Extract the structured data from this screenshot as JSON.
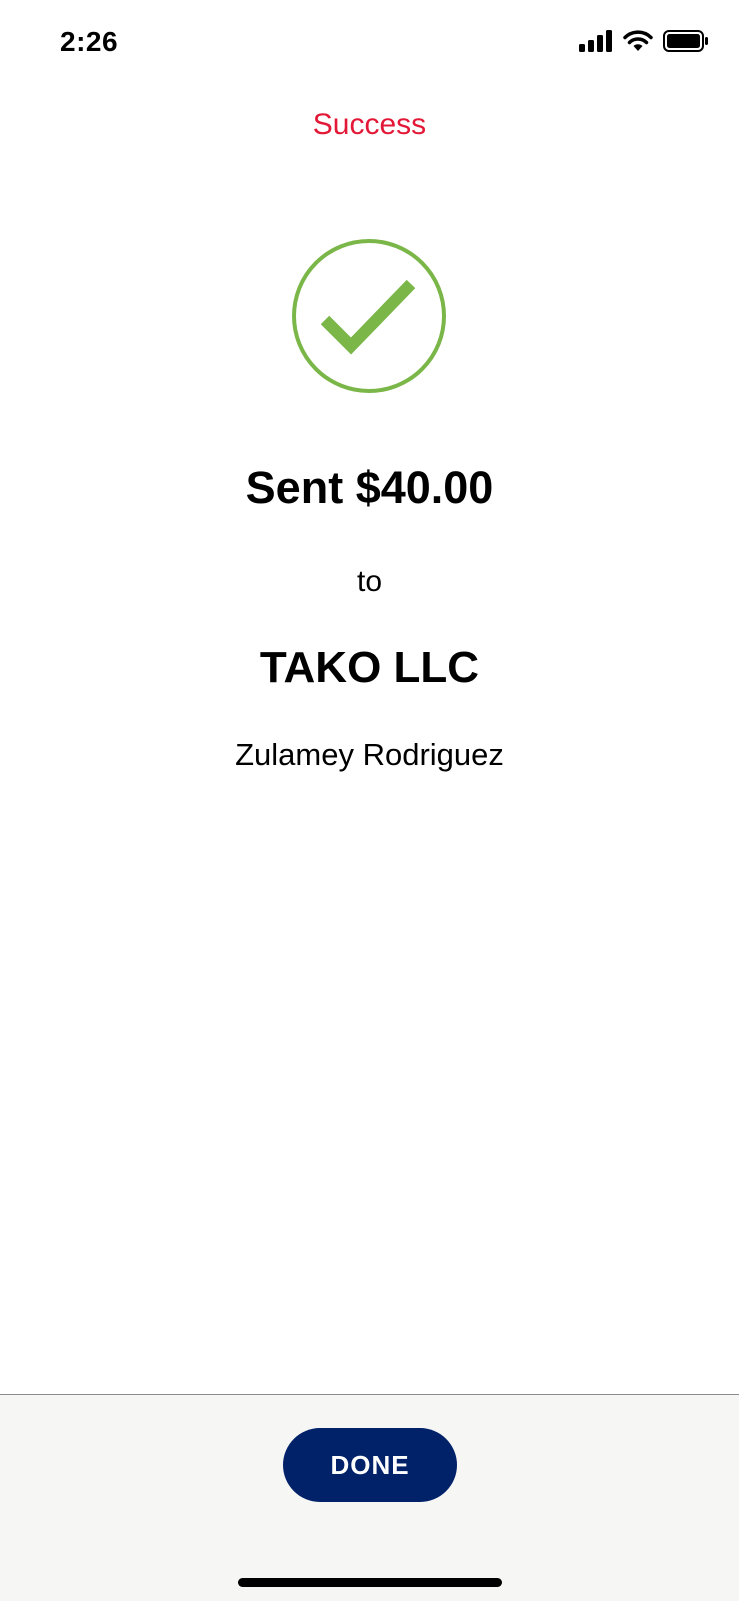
{
  "status_bar": {
    "time": "2:26",
    "icons": [
      "signal-icon",
      "wifi-icon",
      "battery-icon"
    ]
  },
  "header": {
    "title": "Success"
  },
  "confirmation": {
    "icon": "check-circle-icon",
    "amount_text": "Sent $40.00",
    "connector_text": "to",
    "recipient_name": "TAKO LLC",
    "contact_name": "Zulamey Rodriguez"
  },
  "footer": {
    "done_label": "DONE"
  },
  "colors": {
    "title_red": "#e31837",
    "success_green": "#7ab648",
    "button_navy": "#012169",
    "footer_bg": "#f6f6f4"
  }
}
